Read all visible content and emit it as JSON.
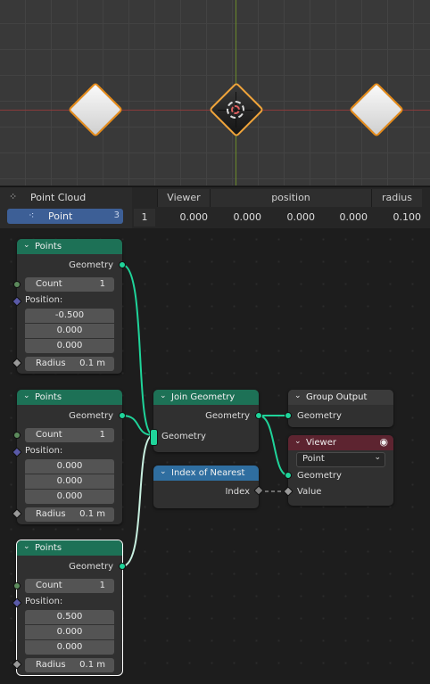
{
  "spreadsheet": {
    "domain_label": "Point Cloud",
    "selected_item": {
      "label": "Point",
      "count": "3"
    },
    "columns": [
      "Viewer",
      "position",
      "radius"
    ],
    "row": {
      "index": "1",
      "viewer": "0.000",
      "pos_x": "0.000",
      "pos_y": "0.000",
      "pos_z": "0.000",
      "radius": "0.100"
    }
  },
  "nodes": {
    "points1": {
      "title": "Points",
      "output": "Geometry",
      "count_label": "Count",
      "count": "1",
      "position_label": "Position:",
      "x": "-0.500",
      "y": "0.000",
      "z": "0.000",
      "radius_label": "Radius",
      "radius": "0.1 m"
    },
    "points2": {
      "title": "Points",
      "output": "Geometry",
      "count_label": "Count",
      "count": "1",
      "position_label": "Position:",
      "x": "0.000",
      "y": "0.000",
      "z": "0.000",
      "radius_label": "Radius",
      "radius": "0.1 m"
    },
    "points3": {
      "title": "Points",
      "output": "Geometry",
      "count_label": "Count",
      "count": "1",
      "position_label": "Position:",
      "x": "0.500",
      "y": "0.000",
      "z": "0.000",
      "radius_label": "Radius",
      "radius": "0.1 m"
    },
    "join": {
      "title": "Join Geometry",
      "output": "Geometry",
      "input": "Geometry"
    },
    "nearest": {
      "title": "Index of Nearest",
      "output": "Index"
    },
    "group_output": {
      "title": "Group Output",
      "input": "Geometry"
    },
    "viewer": {
      "title": "Viewer",
      "domain": "Point",
      "input_geometry": "Geometry",
      "input_value": "Value"
    }
  },
  "colors": {
    "geometry_header": "#1d7156",
    "utility_header": "#2f6ea0",
    "viewer_header": "#5d2430",
    "geometry_socket": "#1fd49a",
    "selection": "#e88d1a",
    "active_row": "#3d5f96"
  },
  "icons": [
    "point-cloud-icon",
    "point-domain-icon",
    "chevron-down-icon",
    "eye-icon"
  ]
}
